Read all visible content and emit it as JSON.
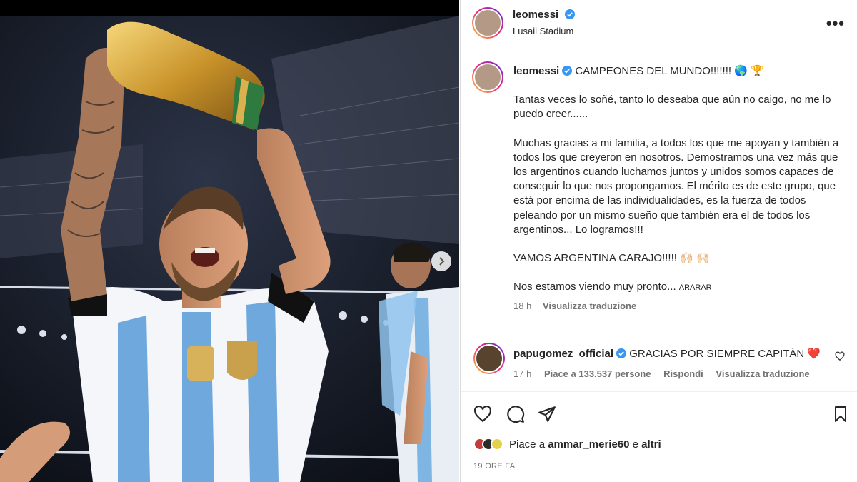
{
  "post": {
    "username": "leomessi",
    "location": "Lusail Stadium"
  },
  "caption": {
    "username": "leomessi",
    "headline": "CAMPEONES DEL MUNDO!!!!!!! 🌎 🏆",
    "paragraphs": [
      "Tantas veces lo soñé, tanto lo deseaba que aún no caigo, no me lo puedo creer......",
      "Muchas gracias a mi familia, a todos los que me apoyan y también a todos los que creyeron en nosotros. Demostramos una vez más que los argentinos cuando luchamos juntos y unidos somos capaces de conseguir lo que nos propongamos. El mérito es de este grupo, que está por encima de las individualidades, es la fuerza de todos peleando por un mismo sueño que también era el de todos los argentinos... Lo logramos!!!",
      "VAMOS ARGENTINA CARAJO!!!!! 🙌🏻 🙌🏻"
    ],
    "last_line": "Nos estamos viendo muy pronto...",
    "last_line_small": "ARARAR",
    "time": "18 h",
    "translate": "Visualizza traduzione"
  },
  "comment": {
    "username": "papugomez_official",
    "text": "GRACIAS POR SIEMPRE CAPITÁN ❤️",
    "time": "17 h",
    "likes": "Piace a 133.537 persone",
    "reply": "Rispondi",
    "translate": "Visualizza traduzione"
  },
  "likes": {
    "prefix": "Piace a",
    "user": "ammar_merie60",
    "conj": "e",
    "others": "altri"
  },
  "timestamp": "19 ORE FA",
  "colors": {
    "verified": "#3897f0",
    "muted": "#737373",
    "text": "#262626",
    "heart": "#ed4956"
  },
  "icons": [
    "verified-badge-icon",
    "more-options-icon",
    "next-slide-icon",
    "like-icon",
    "comment-icon",
    "share-icon",
    "save-icon",
    "comment-like-icon"
  ]
}
